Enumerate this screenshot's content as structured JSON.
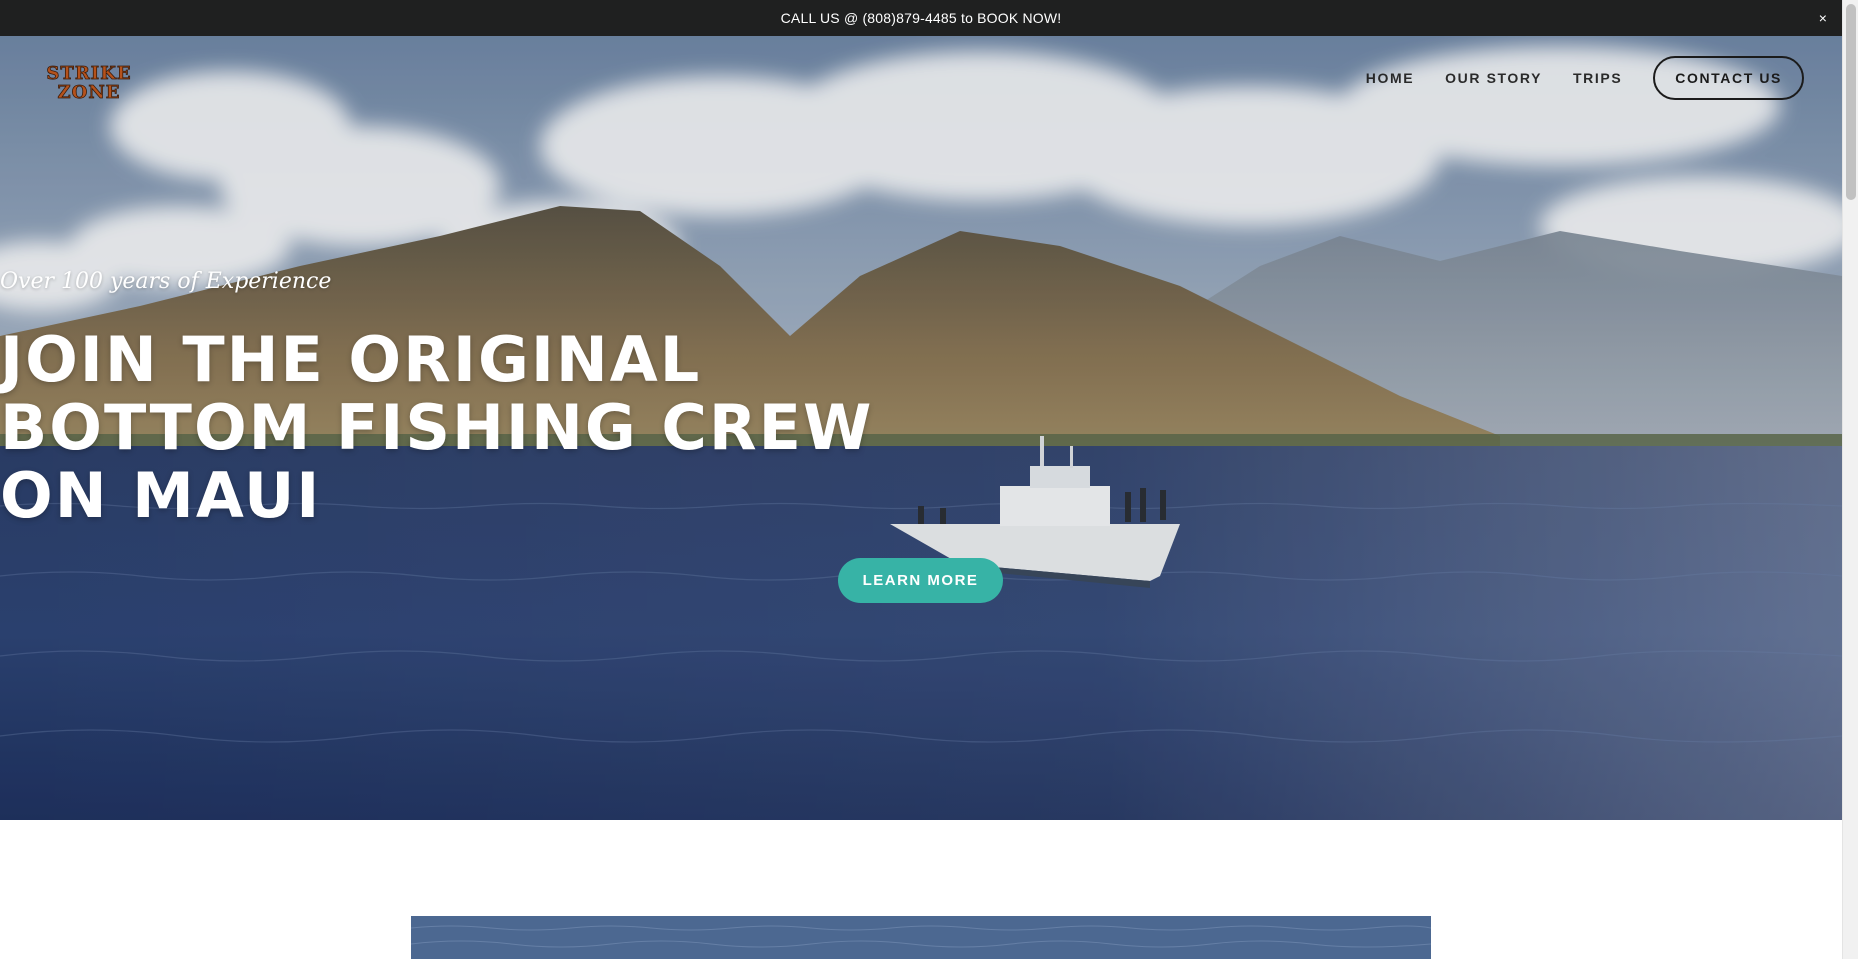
{
  "announcement": {
    "text": "CALL US @ (808)879-4485 to BOOK NOW!",
    "close_symbol": "×"
  },
  "logo": {
    "line1": "STRIKE",
    "line2": "ZONE"
  },
  "nav": {
    "items": [
      {
        "label": "HOME"
      },
      {
        "label": "OUR STORY"
      },
      {
        "label": "TRIPS"
      }
    ],
    "contact_label": "CONTACT US"
  },
  "hero": {
    "tagline": "Over 100 years of Experience",
    "headline_line1": "JOIN THE ORIGINAL",
    "headline_line2": "BOTTOM FISHING CREW",
    "headline_line3": "ON MAUI",
    "cta_label": "LEARN MORE"
  },
  "colors": {
    "announcement_bg": "#1f2020",
    "accent": "#37b3a6",
    "text_dark": "#1b1b1b"
  }
}
